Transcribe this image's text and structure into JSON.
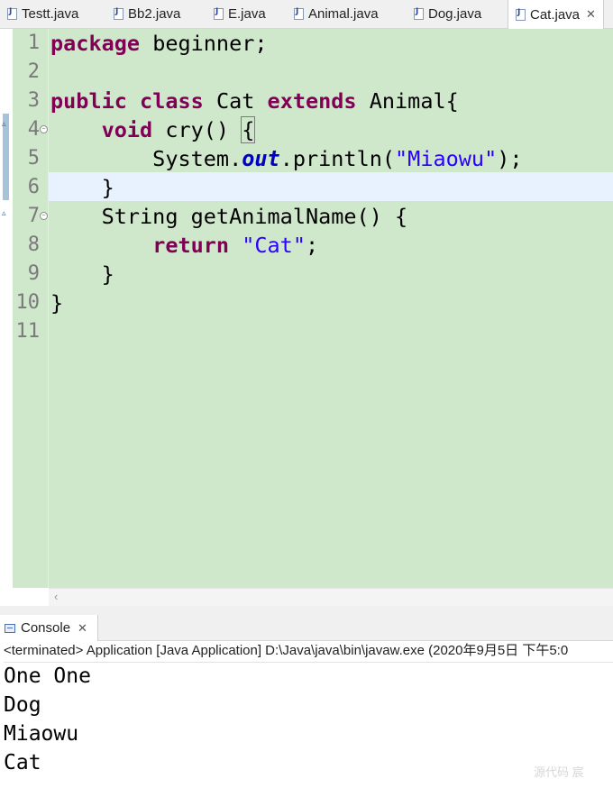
{
  "tabs": [
    {
      "label": "Testt.java",
      "active": false
    },
    {
      "label": "Bb2.java",
      "active": false
    },
    {
      "label": "E.java",
      "active": false
    },
    {
      "label": "Animal.java",
      "active": false
    },
    {
      "label": "Dog.java",
      "active": false
    },
    {
      "label": "Cat.java",
      "active": true
    }
  ],
  "tab_close_glyph": "✕",
  "editor": {
    "line_numbers": [
      "1",
      "2",
      "3",
      "4",
      "5",
      "6",
      "7",
      "8",
      "9",
      "10",
      "11"
    ],
    "code": {
      "l1_kw": "package",
      "l1_rest": " beginner;",
      "l3_kw1": "public",
      "l3_kw2": "class",
      "l3_mid": " Cat ",
      "l3_kw3": "extends",
      "l3_rest": " Animal{",
      "l4_indent": "    ",
      "l4_kw": "void",
      "l4_mid": " cry() ",
      "l4_brace": "{",
      "l5_pre": "        System.",
      "l5_field": "out",
      "l5_mid": ".println(",
      "l5_str": "\"Miaowu\"",
      "l5_end": ");",
      "l6": "    }",
      "l7": "    String getAnimalName() {",
      "l8_indent": "        ",
      "l8_kw": "return",
      "l8_sp": " ",
      "l8_str": "\"Cat\"",
      "l8_end": ";",
      "l9": "    }",
      "l10": "}"
    },
    "colors": {
      "background": "#cfe8cb",
      "keyword": "#7f0055",
      "string": "#2a00ff",
      "current_line": "#e8f2fe"
    }
  },
  "console": {
    "tab_label": "Console",
    "close_glyph": "✕",
    "status": "<terminated> Application [Java Application] D:\\Java\\java\\bin\\javaw.exe  (2020年9月5日 下午5:0",
    "output": [
      "One One",
      "Dog",
      "Miaowu",
      "Cat"
    ]
  },
  "watermark": "源代码   宸"
}
